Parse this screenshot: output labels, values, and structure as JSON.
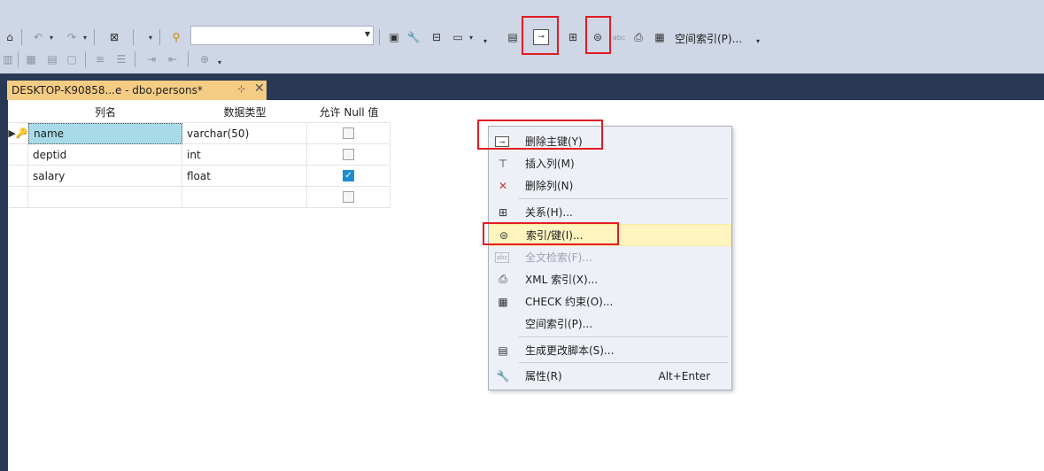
{
  "toolbar": {
    "combo_value": "",
    "spatial_index_label": "空间索引(P)..."
  },
  "tab": {
    "title": "DESKTOP-K90858...e - dbo.persons*",
    "pin": "⊹",
    "close": "✕"
  },
  "grid": {
    "headers": [
      "列名",
      "数据类型",
      "允许 Null 值"
    ],
    "rows": [
      {
        "name": "name",
        "type": "varchar(50)",
        "allow_null": false,
        "key": true
      },
      {
        "name": "deptid",
        "type": "int",
        "allow_null": false,
        "key": false
      },
      {
        "name": "salary",
        "type": "float",
        "allow_null": true,
        "key": false
      },
      {
        "name": "",
        "type": "",
        "allow_null": false,
        "key": false
      }
    ]
  },
  "context_menu": {
    "items": [
      {
        "label": "删除主键(Y)",
        "icon": "key-icon"
      },
      {
        "label": "插入列(M)",
        "icon": "insert-column-icon"
      },
      {
        "label": "删除列(N)",
        "icon": "delete-column-icon"
      },
      {
        "label": "关系(H)...",
        "icon": "relationships-icon"
      },
      {
        "label": "索引/键(I)...",
        "icon": "index-key-icon"
      },
      {
        "label": "全文检索(F)...",
        "icon": "fulltext-icon"
      },
      {
        "label": "XML 索引(X)...",
        "icon": "xml-index-icon"
      },
      {
        "label": "CHECK 约束(O)...",
        "icon": "check-constraint-icon"
      },
      {
        "label": "空间索引(P)...",
        "icon": ""
      },
      {
        "label": "生成更改脚本(S)...",
        "icon": "script-icon"
      },
      {
        "label": "属性(R)",
        "icon": "wrench-icon"
      }
    ],
    "properties_shortcut": "Alt+Enter"
  },
  "colors": {
    "toolbar_bg": "#cfd6e5",
    "tabbar_bg": "#293955",
    "active_tab": "#f5cc84",
    "highlight_red": "#e31b23",
    "menu_hover": "#fdf4bf",
    "checkbox_checked": "#1b8fd1"
  }
}
